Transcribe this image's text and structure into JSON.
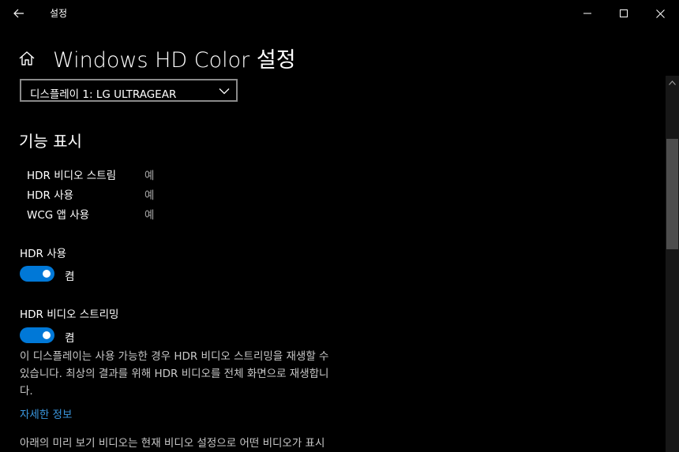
{
  "window": {
    "title": "설정",
    "back_icon": "back-arrow-icon",
    "minimize_icon": "minimize-icon",
    "maximize_icon": "maximize-icon",
    "close_icon": "close-icon"
  },
  "header": {
    "home_icon": "home-icon",
    "title": "Windows HD Color 설정"
  },
  "display_select": {
    "selected": "디스플레이 1: LG ULTRAGEAR",
    "chevron_icon": "chevron-down-icon"
  },
  "capabilities": {
    "heading": "기능 표시",
    "rows": [
      {
        "label": "HDR 비디오 스트림",
        "value": "예"
      },
      {
        "label": "HDR 사용",
        "value": "예"
      },
      {
        "label": "WCG 앱 사용",
        "value": "예"
      }
    ]
  },
  "hdr_toggle": {
    "title": "HDR 사용",
    "state": "켬",
    "on": true
  },
  "hdr_video_toggle": {
    "title": "HDR 비디오 스트리밍",
    "state": "켬",
    "on": true
  },
  "description": {
    "line1": "이 디스플레이는 사용 가능한 경우 HDR 비디오 스트리밍을 재생할 수",
    "line2": "있습니다. 최상의 결과를 위해 HDR 비디오를 전체 화면으로 재생합니",
    "line3": "다."
  },
  "more_info_link": "자세한 정보",
  "preview_description": "아래의 미리 보기 비디오는 현재 비디오 설정으로 어떤 비디오가 표시",
  "colors": {
    "background": "#000000",
    "accent": "#0078d7",
    "link": "#3a96dd"
  }
}
